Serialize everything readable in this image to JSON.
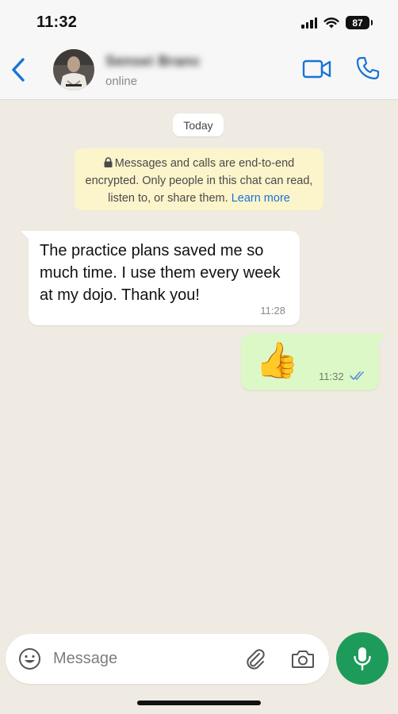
{
  "status_bar": {
    "time": "11:32",
    "battery": "87"
  },
  "header": {
    "contact_name": "Sensei Branc",
    "status": "online"
  },
  "chat": {
    "date_label": "Today",
    "encryption_notice": "Messages and calls are end-to-end encrypted. Only people in this chat can read, listen to, or share them.",
    "learn_more": "Learn more",
    "messages": [
      {
        "direction": "incoming",
        "text": "The practice plans saved me so much time. I use them every week at my dojo. Thank you!",
        "time": "11:28"
      },
      {
        "direction": "outgoing",
        "text": "👍",
        "time": "11:32",
        "status": "read"
      }
    ]
  },
  "composer": {
    "placeholder": "Message"
  },
  "colors": {
    "accent_blue": "#1774d6",
    "chat_bg": "#efeae2",
    "outgoing_bubble": "#dcf8c6",
    "notice_bg": "#fcf4cb",
    "mic_green": "#1d9b5a"
  },
  "icons": [
    "back-chevron-icon",
    "video-call-icon",
    "phone-call-icon",
    "lock-icon",
    "double-check-icon",
    "emoji-icon",
    "paperclip-icon",
    "camera-icon",
    "microphone-icon"
  ]
}
